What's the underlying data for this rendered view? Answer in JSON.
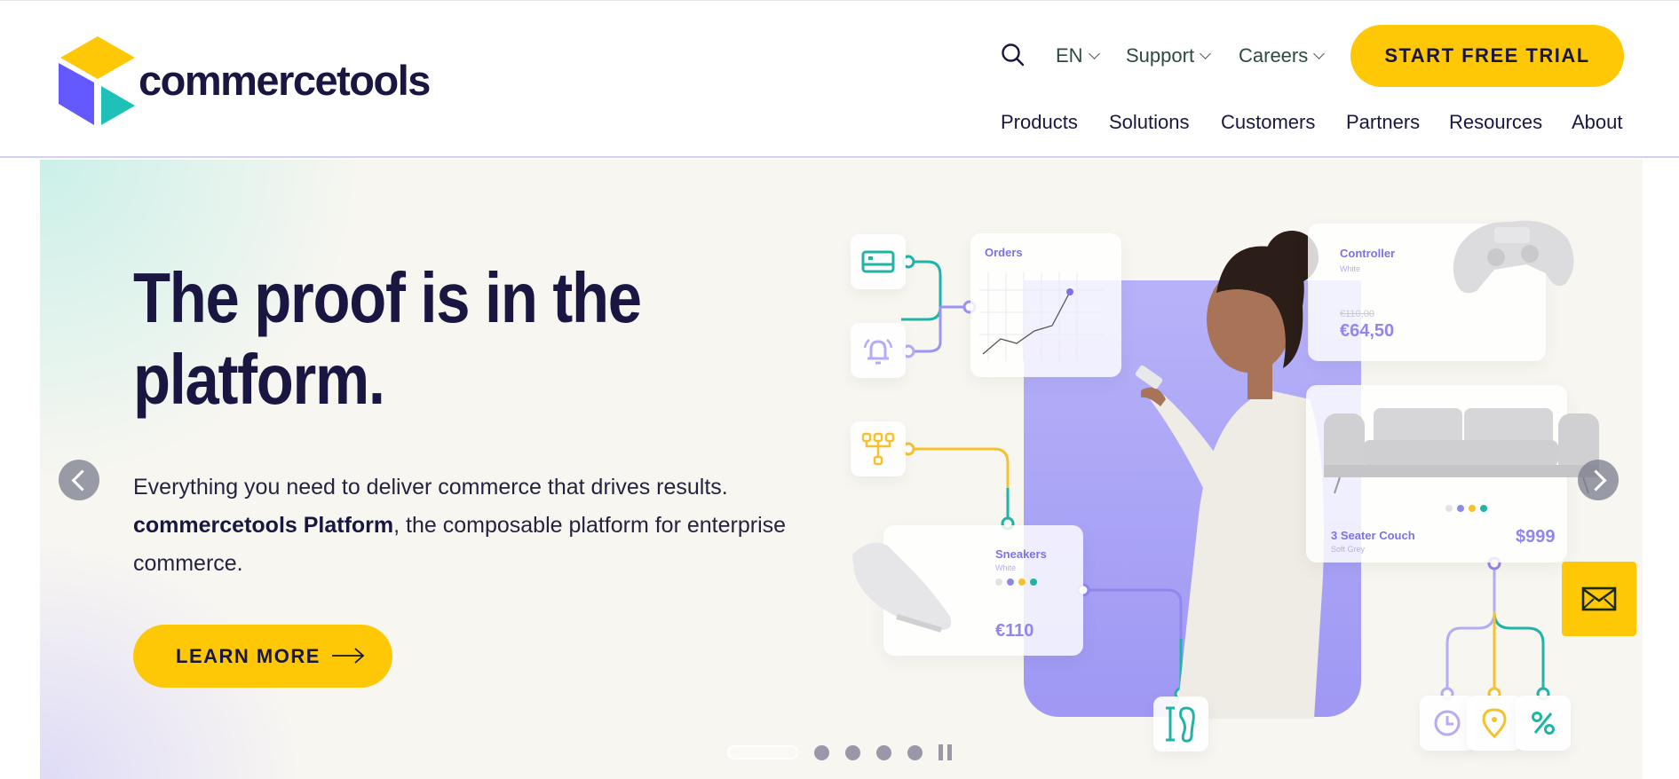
{
  "header": {
    "logo_text": "commercetools",
    "search_icon": "search-icon",
    "language": "EN",
    "support": "Support",
    "careers": "Careers",
    "cta": "START FREE TRIAL",
    "nav": [
      "Products",
      "Solutions",
      "Customers",
      "Partners",
      "Resources",
      "About"
    ]
  },
  "hero": {
    "headline": "The proof is in the platform.",
    "sub_line1": "Everything you need to deliver commerce that drives results.",
    "sub_bold": "commercetools Platform",
    "sub_rest": ", the composable platform for enterprise commerce.",
    "learn_more": "LEARN MORE",
    "prev_icon": "chevron-left-icon",
    "next_icon": "chevron-right-icon"
  },
  "illustration": {
    "orders_title": "Orders",
    "controller": {
      "title": "Controller",
      "subtitle": "White",
      "old_price": "€110,00",
      "price": "€64,50"
    },
    "couch": {
      "title": "3 Seater Couch",
      "subtitle": "Soft Grey",
      "price": "$999"
    },
    "sneakers": {
      "title": "Sneakers",
      "subtitle": "White",
      "price": "€110"
    },
    "colors": {
      "purple": "#8f87ec",
      "yellow": "#f6c22b",
      "teal": "#1fb4a6",
      "grey": "#e3e3e6"
    }
  },
  "pager": {
    "slides": 5,
    "active_index": 0,
    "pause_icon": "pause-icon"
  },
  "mail_button": {
    "icon": "mail-icon"
  },
  "brand": {
    "yellow": "#ffc806",
    "navy": "#191741",
    "purple": "#6359ff",
    "teal": "#1ec0b7"
  }
}
